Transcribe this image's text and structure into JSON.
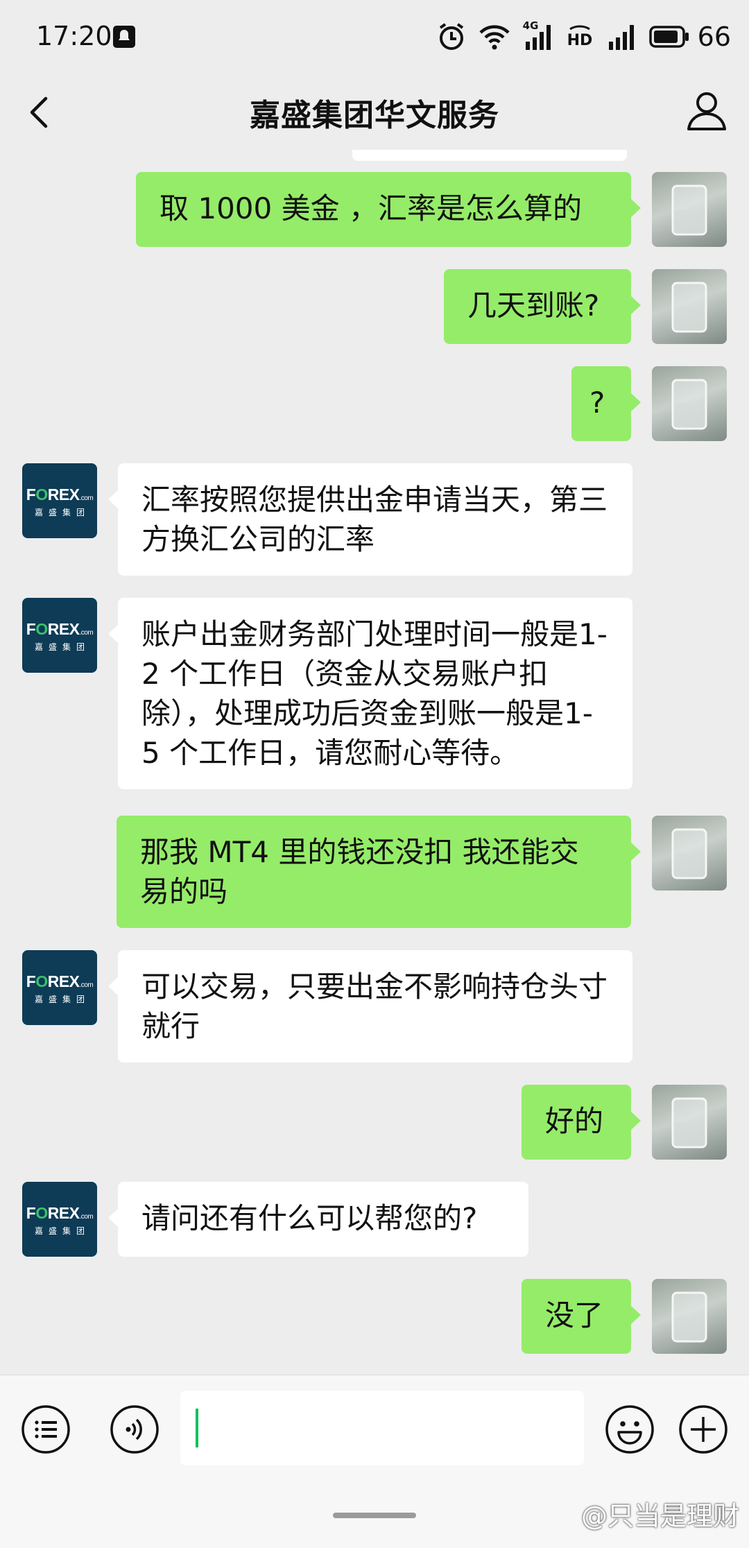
{
  "status_bar": {
    "time": "17:20",
    "network_label": "4G",
    "hd_label": "HD",
    "battery": "66"
  },
  "header": {
    "title": "嘉盛集团华文服务"
  },
  "avatar_logo": {
    "top": "FOREX",
    "suffix": ".com",
    "bottom": "嘉盛集团"
  },
  "messages": [
    {
      "from": "me",
      "text": "取 1000 美金 ，汇率是怎么算的"
    },
    {
      "from": "me",
      "text": "几天到账?"
    },
    {
      "from": "me",
      "text": "?"
    },
    {
      "from": "them",
      "text": "汇率按照您提供出金申请当天，第三方换汇公司的汇率"
    },
    {
      "from": "them",
      "text": "账户出金财务部门处理时间一般是1-2 个工作日（资金从交易账户扣除），处理成功后资金到账一般是1-5 个工作日，请您耐心等待。"
    },
    {
      "from": "me",
      "text": "那我 MT4 里的钱还没扣 我还能交易的吗"
    },
    {
      "from": "them",
      "text": "可以交易，只要出金不影响持仓头寸就行"
    },
    {
      "from": "me",
      "text": "好的"
    },
    {
      "from": "them",
      "text": "请问还有什么可以帮您的?"
    },
    {
      "from": "me",
      "text": "没了"
    }
  ],
  "input": {
    "value": ""
  },
  "watermark": "@只当是理财",
  "colors": {
    "background": "#ededed",
    "my_bubble": "#95ec69",
    "their_bubble": "#ffffff",
    "accent": "#07c160",
    "logo_bg": "#0e3b56"
  }
}
